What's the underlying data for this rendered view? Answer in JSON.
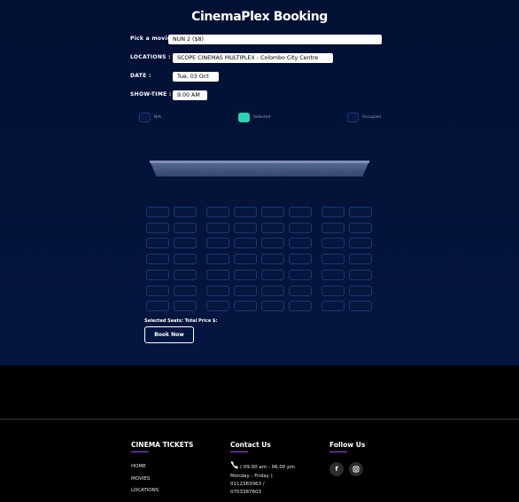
{
  "app": {
    "title": "CinemaPlex Booking"
  },
  "form": {
    "movie_label": "Pick a movie:",
    "movie_value": "NUN 2 ($8)",
    "location_label": "LOCATIONS :",
    "location_value": "SCOPE CINEMAS MULTIPLEX - Colombo City Centre",
    "date_label": "DATE :",
    "date_value": "Tue, 03 Oct",
    "showtime_label": "SHOW-TIME :",
    "showtime_value": "9.00 AM"
  },
  "legend": {
    "na": "N/A",
    "selected": "Selected",
    "occupied": "Occupied"
  },
  "seating": {
    "rows": 7,
    "seats_per_row": 8,
    "selected_count": 0,
    "occupied_count": 0
  },
  "summary": {
    "text": "Selected Seats: Total Price $:"
  },
  "actions": {
    "book_label": "Book Now"
  },
  "footer": {
    "tickets_heading": "CINEMA TICKETS",
    "links": [
      "HOME",
      "MOVIES",
      "LOCATIONS"
    ],
    "contact_heading": "Contact Us",
    "contact_hours": "( 09.00 am - 06.00 pm",
    "contact_days": "Monday - Friday )",
    "phone_1": "0112383063 /",
    "phone_2": "0703387603",
    "follow_heading": "Follow Us",
    "social_icons": [
      "facebook-icon",
      "instagram-icon"
    ]
  },
  "colors": {
    "background_top": "#021033",
    "seat_border": "#1b3670",
    "selected": "#2bd3b4",
    "accent_underline": "#a23cff"
  }
}
